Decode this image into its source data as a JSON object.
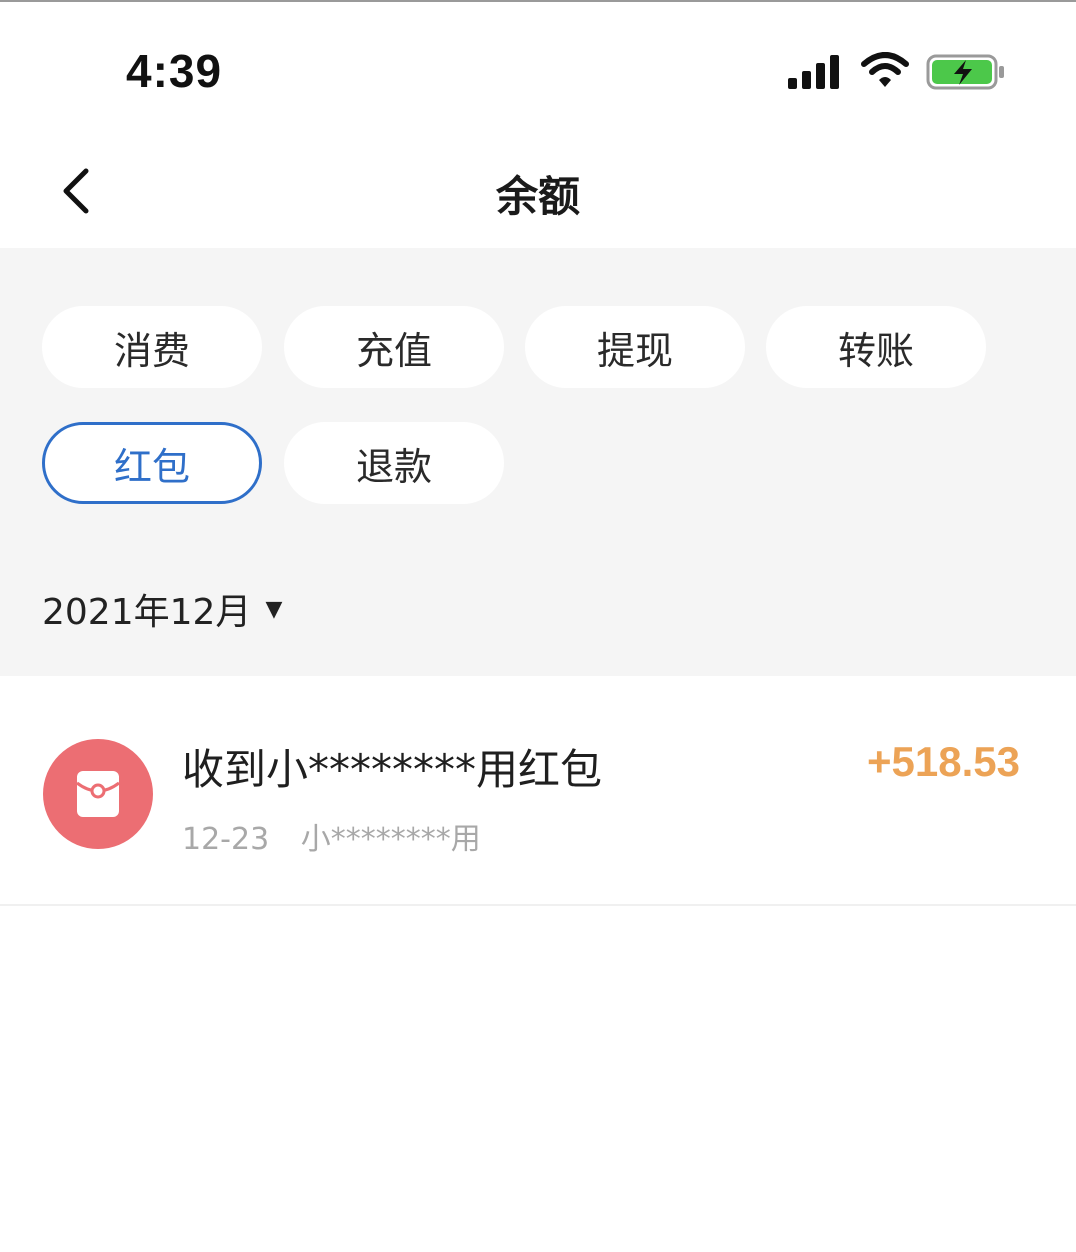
{
  "status_bar": {
    "time": "4:39",
    "icons": [
      "cellular-signal-icon",
      "wifi-icon",
      "battery-charging-icon"
    ],
    "battery_color": "#4cc84a"
  },
  "nav": {
    "title": "余额",
    "back_icon": "chevron-left-icon"
  },
  "filters": {
    "items": [
      {
        "label": "消费",
        "selected": false
      },
      {
        "label": "充值",
        "selected": false
      },
      {
        "label": "提现",
        "selected": false
      },
      {
        "label": "转账",
        "selected": false
      },
      {
        "label": "红包",
        "selected": true
      },
      {
        "label": "退款",
        "selected": false
      }
    ],
    "active_color": "#2f6fc9"
  },
  "month_selector": {
    "label": "2021年12月",
    "caret_icon": "caret-down-icon"
  },
  "transactions": [
    {
      "icon": "red-envelope-icon",
      "icon_color": "#ec6e73",
      "title": "收到小********用红包",
      "date": "12-23",
      "counterparty": "小********用",
      "amount": "+518.53",
      "amount_color": "#eca356"
    }
  ]
}
